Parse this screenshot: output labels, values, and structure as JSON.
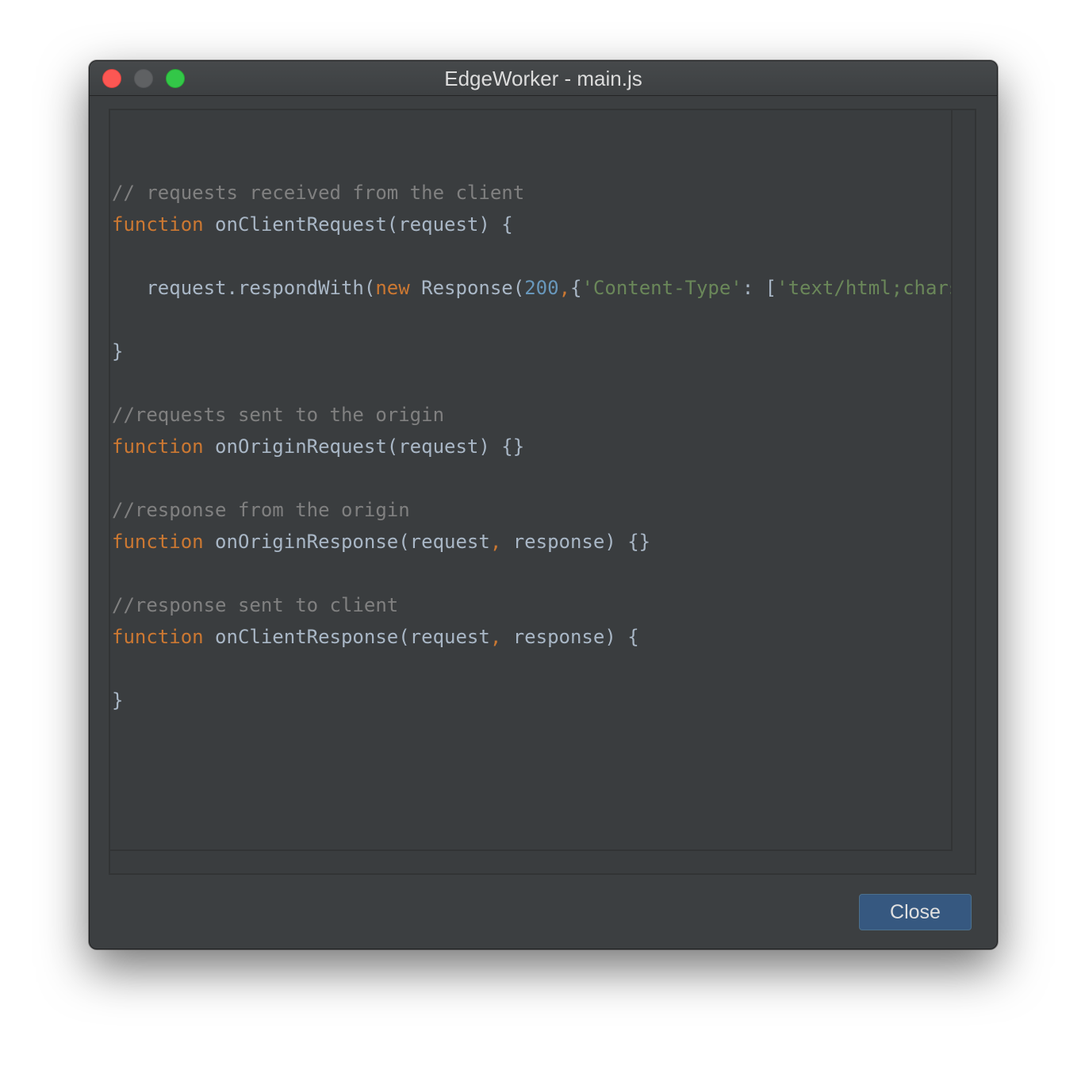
{
  "window": {
    "title": "EdgeWorker - main.js"
  },
  "editor": {
    "lines": [
      [],
      [
        {
          "t": "// requests received from the client",
          "c": "comment"
        }
      ],
      [
        {
          "t": "function",
          "c": "keyword"
        },
        {
          "t": " onClientRequest(request) {",
          "c": "plain"
        }
      ],
      [],
      [
        {
          "t": "   request.respondWith(",
          "c": "plain"
        },
        {
          "t": "new",
          "c": "keyword"
        },
        {
          "t": " Response(",
          "c": "plain"
        },
        {
          "t": "200",
          "c": "number"
        },
        {
          "t": ",",
          "c": "punct"
        },
        {
          "t": "{",
          "c": "plain"
        },
        {
          "t": "'Content-Type'",
          "c": "string"
        },
        {
          "t": ": [",
          "c": "plain"
        },
        {
          "t": "'text/html;charset=ut",
          "c": "string"
        }
      ],
      [],
      [
        {
          "t": "}",
          "c": "plain"
        }
      ],
      [],
      [
        {
          "t": "//requests sent to the origin",
          "c": "comment"
        }
      ],
      [
        {
          "t": "function",
          "c": "keyword"
        },
        {
          "t": " onOriginRequest(request) {}",
          "c": "plain"
        }
      ],
      [],
      [
        {
          "t": "//response from the origin",
          "c": "comment"
        }
      ],
      [
        {
          "t": "function",
          "c": "keyword"
        },
        {
          "t": " onOriginResponse(request",
          "c": "plain"
        },
        {
          "t": ",",
          "c": "punct"
        },
        {
          "t": " response) {}",
          "c": "plain"
        }
      ],
      [],
      [
        {
          "t": "//response sent to client",
          "c": "comment"
        }
      ],
      [
        {
          "t": "function",
          "c": "keyword"
        },
        {
          "t": " onClientResponse(request",
          "c": "plain"
        },
        {
          "t": ",",
          "c": "punct"
        },
        {
          "t": " response) {",
          "c": "plain"
        }
      ],
      [],
      [
        {
          "t": "}",
          "c": "plain"
        }
      ]
    ]
  },
  "buttons": {
    "close_label": "Close"
  },
  "colors": {
    "background": "#3c3f41",
    "keyword": "#cc7832",
    "comment": "#808080",
    "string": "#6a8759",
    "number": "#6897bb",
    "text": "#a9b7c6",
    "button": "#365880",
    "traffic_close": "#fc5753",
    "traffic_minimize": "#5f6163",
    "traffic_zoom": "#33c748"
  }
}
